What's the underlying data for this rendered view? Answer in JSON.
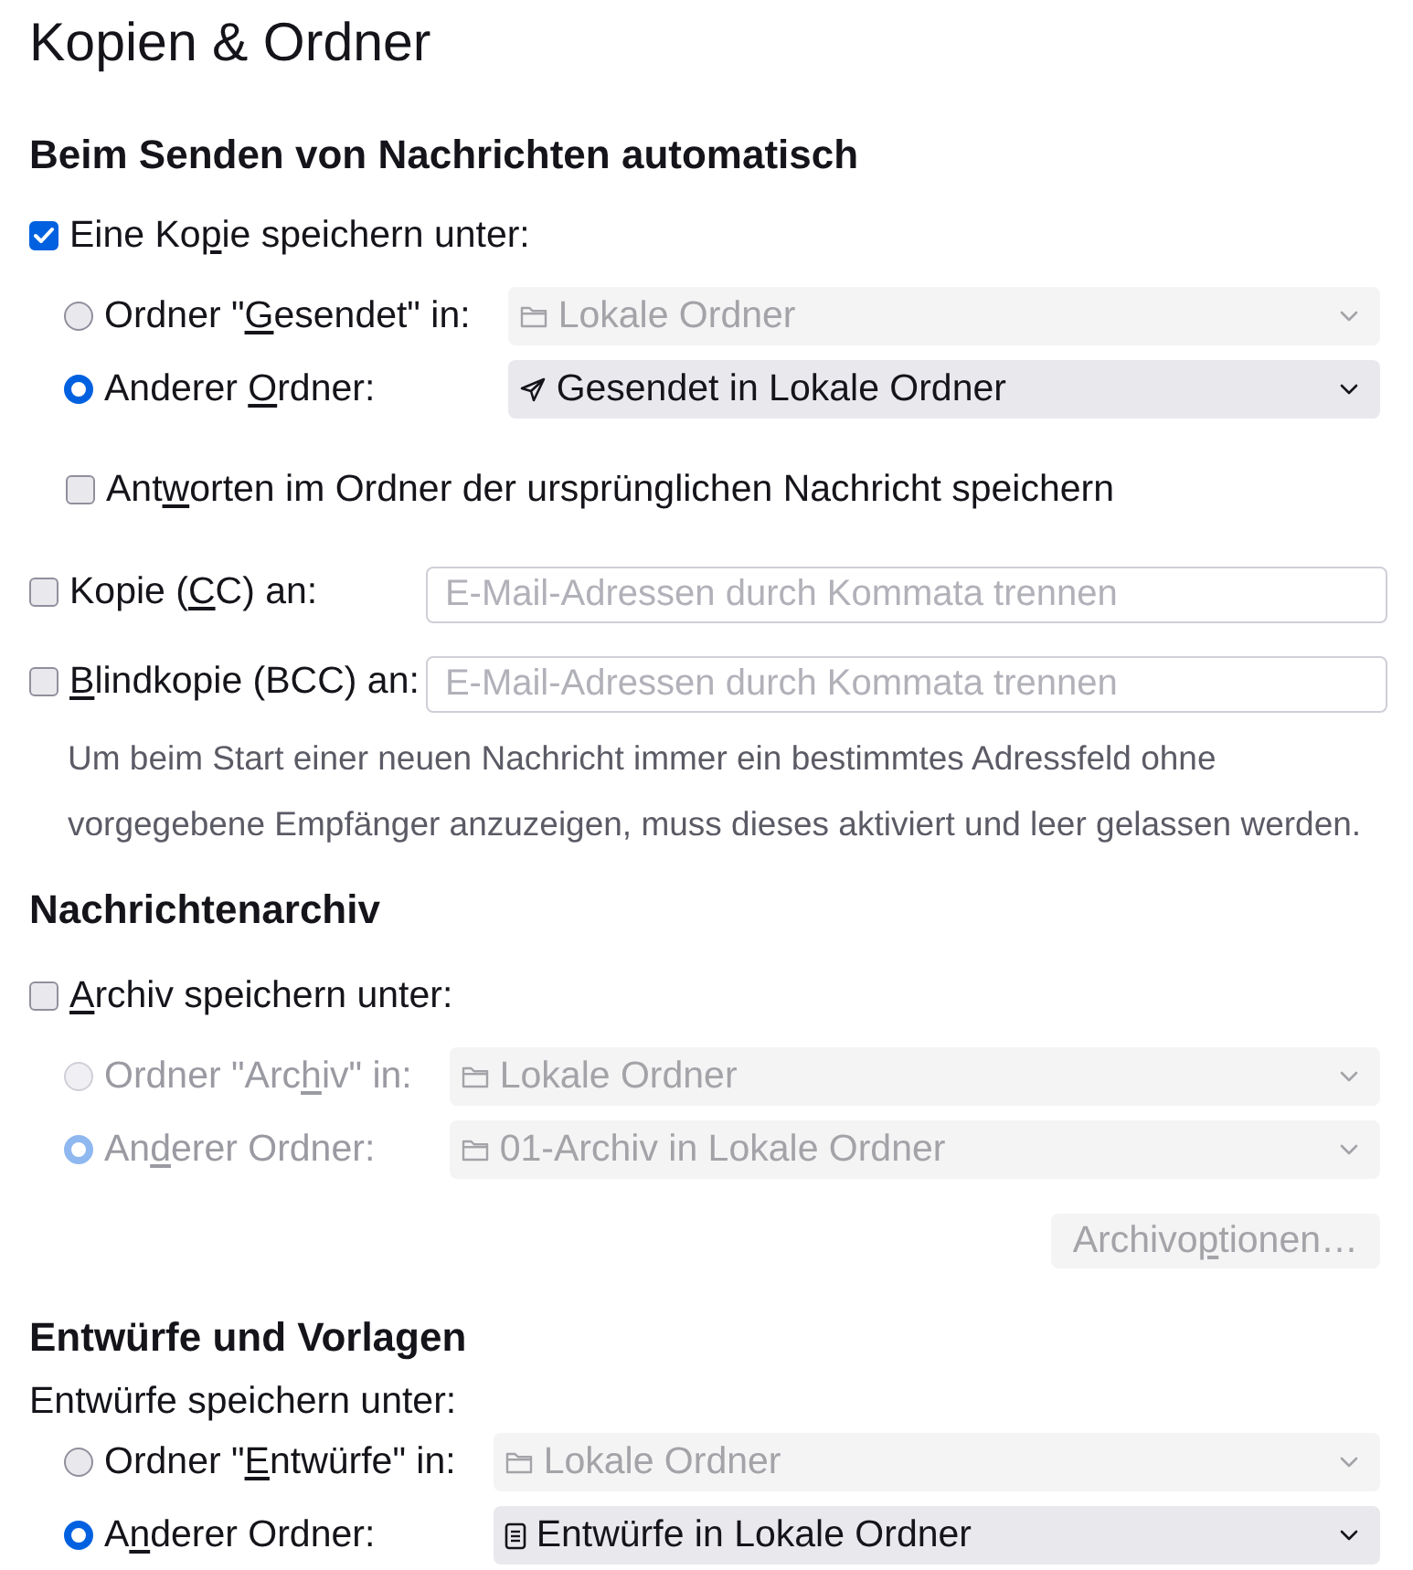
{
  "title": "Kopien & Ordner",
  "sending": {
    "heading": "Beim Senden von Nachrichten automatisch",
    "save_copy": {
      "label": {
        "before": "Eine Ko",
        "key": "p",
        "after": "ie speichern unter:"
      },
      "checked": true
    },
    "folder_choices": [
      {
        "label": {
          "before": "Ordner \"",
          "key": "G",
          "after": "esendet\" in:"
        },
        "selected": false,
        "disabled": false,
        "dropdown": {
          "kind": "folder",
          "value": "Lokale Ordner",
          "disabled": true
        }
      },
      {
        "label": {
          "before": "Anderer ",
          "key": "O",
          "after": "rdner:"
        },
        "selected": true,
        "disabled": false,
        "dropdown": {
          "kind": "sent",
          "value": "Gesendet in Lokale Ordner",
          "disabled": false
        }
      }
    ],
    "reply_in_original": {
      "label": {
        "before": "Ant",
        "key": "w",
        "after": "orten im Ordner der ursprünglichen Nachricht speichern"
      },
      "checked": false
    },
    "recipients": [
      {
        "label": {
          "before": "Kopie (",
          "key": "C",
          "after": "C) an:"
        },
        "checked": false,
        "placeholder": "E-Mail-Adressen durch Kommata trennen"
      },
      {
        "label": {
          "key": "B",
          "after": "lindkopie (BCC) an:"
        },
        "checked": false,
        "placeholder": "E-Mail-Adressen durch Kommata trennen"
      }
    ],
    "note": "Um beim Start einer neuen Nachricht immer ein bestimmtes Adressfeld ohne vorgegebene Empfänger anzuzeigen, muss dieses aktiviert und leer gelassen werden."
  },
  "archive": {
    "heading": "Nachrichtenarchiv",
    "save_archive": {
      "label": {
        "key": "A",
        "after": "rchiv speichern unter:"
      },
      "checked": false
    },
    "folder_choices": [
      {
        "label": {
          "before": "Ordner \"Arc",
          "key": "h",
          "after": "iv\" in:"
        },
        "selected": false,
        "disabled": true,
        "dropdown": {
          "kind": "folder",
          "value": "Lokale Ordner",
          "disabled": true
        }
      },
      {
        "label": {
          "before": "An",
          "key": "d",
          "after": "erer Ordner:"
        },
        "selected": true,
        "disabled": true,
        "dropdown": {
          "kind": "folder",
          "value": "01-Archiv in Lokale Ordner",
          "disabled": true
        }
      }
    ],
    "options_button": {
      "label": {
        "before": "Archivo",
        "key": "p",
        "after": "tionen…"
      },
      "disabled": true
    }
  },
  "drafts": {
    "heading": "Entwürfe und Vorlagen",
    "subheading": "Entwürfe speichern unter:",
    "folder_choices": [
      {
        "label": {
          "before": "Ordner \"",
          "key": "E",
          "after": "ntwürfe\" in:"
        },
        "selected": false,
        "disabled": false,
        "dropdown": {
          "kind": "folder",
          "value": "Lokale Ordner",
          "disabled": true
        }
      },
      {
        "label": {
          "before": "A",
          "key": "n",
          "after": "derer Ordner:"
        },
        "selected": true,
        "disabled": false,
        "dropdown": {
          "kind": "document",
          "value": "Entwürfe in Lokale Ordner",
          "disabled": false
        }
      }
    ]
  }
}
